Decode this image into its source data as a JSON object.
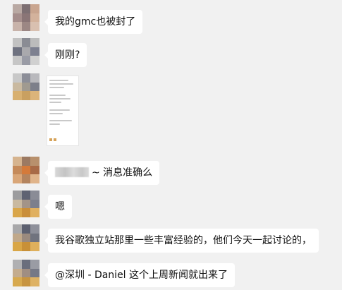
{
  "messages": [
    {
      "text": "我的gmc也被封了"
    },
    {
      "text": "刚刚?"
    },
    {
      "text": ""
    },
    {
      "text": "~ 消息准确么"
    },
    {
      "text": "嗯"
    },
    {
      "text": "我谷歌独立站那里一些丰富经验的，他们今天一起讨论的，"
    },
    {
      "text": "@深圳 - Daniel 这个上周新闻就出来了"
    }
  ],
  "avatar_colors": {
    "a1": [
      "#b9a9a3",
      "#7d6f72",
      "#c9a58f",
      "#a58e8c",
      "#8a7576",
      "#d3b29c",
      "#c8b3aa",
      "#9c8784",
      "#d9c0b0"
    ],
    "a2": [
      "#c2c2c2",
      "#8a8c94",
      "#bcbcbc",
      "#6f7280",
      "#a9a9ad",
      "#7d8090",
      "#c6c6c6",
      "#9a9ca6",
      "#d0d0d0"
    ],
    "a3": [
      "#c8c8c8",
      "#8c8e98",
      "#b9b9bd",
      "#c9b9a0",
      "#a09a90",
      "#7d7f8a",
      "#d8b070",
      "#c9a060",
      "#dcb47a"
    ],
    "a4": [
      "#d6b48f",
      "#9c7a62",
      "#b8906c",
      "#c58a5a",
      "#d47a3a",
      "#a86a46",
      "#d9a678",
      "#b4845e",
      "#e0b48a"
    ],
    "a5": [
      "#9c9c9e",
      "#5e6272",
      "#8a8c96",
      "#c9b9a0",
      "#a39488",
      "#7c7f8c",
      "#d9a64a",
      "#c98e3a",
      "#e0b060"
    ],
    "a6": [
      "#a8a8aa",
      "#5c6070",
      "#8e909a",
      "#c0a88a",
      "#9a8a7e",
      "#70737e",
      "#d9a646",
      "#c89038",
      "#dfb05c"
    ],
    "a7": [
      "#b0b0b2",
      "#6a6e7c",
      "#9a9ca4",
      "#c4ac8e",
      "#a08e82",
      "#767986",
      "#d7a94e",
      "#c79440",
      "#deb264"
    ]
  }
}
